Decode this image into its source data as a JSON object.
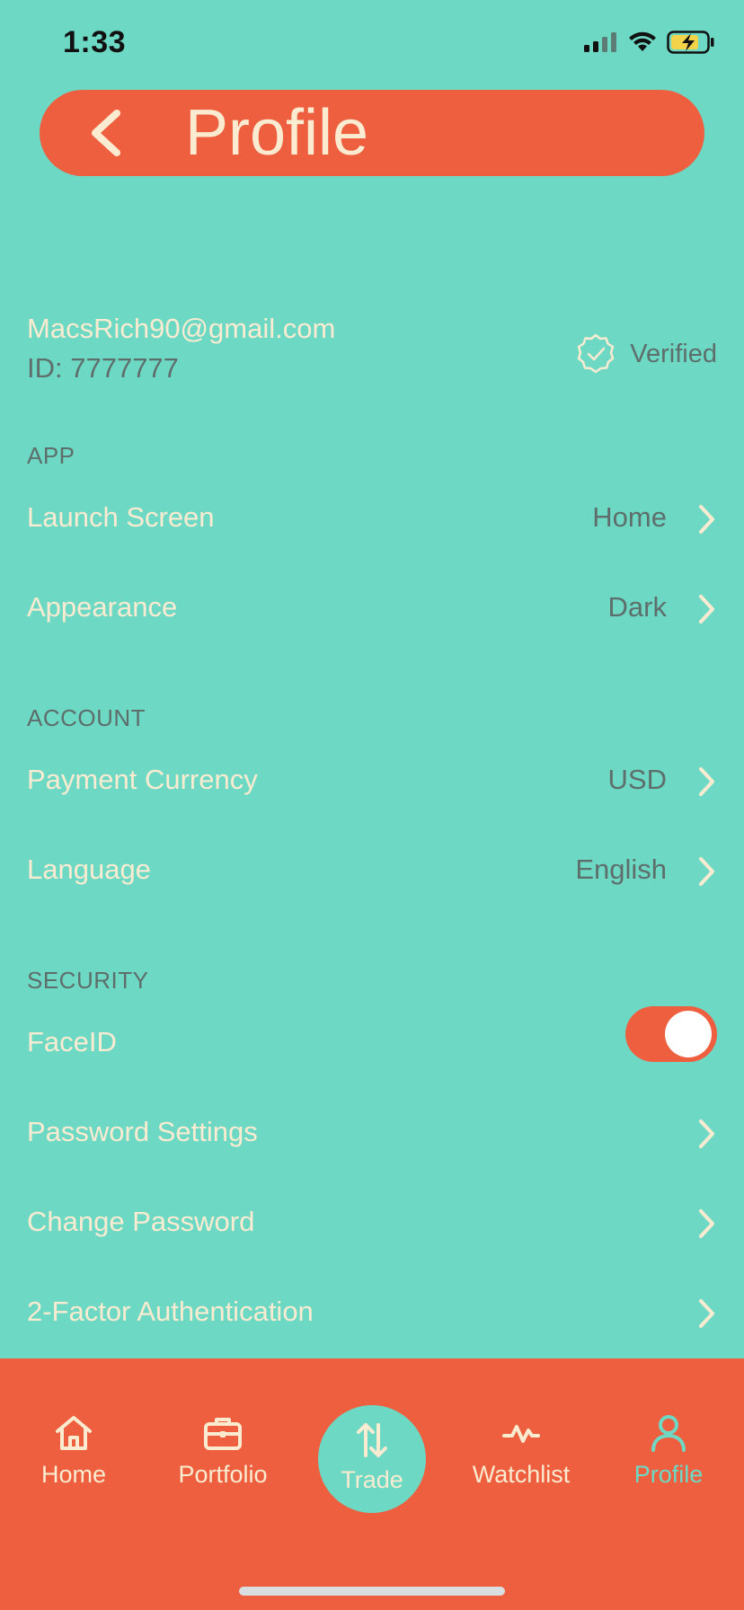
{
  "status_bar": {
    "time": "1:33"
  },
  "header": {
    "title": "Profile"
  },
  "user": {
    "email": "MacsRich90@gmail.com",
    "id_text": "ID: 7777777",
    "verified_label": "Verified"
  },
  "sections": {
    "app": {
      "title": "APP",
      "items": [
        {
          "label": "Launch Screen",
          "value": "Home"
        },
        {
          "label": "Appearance",
          "value": "Dark"
        }
      ]
    },
    "account": {
      "title": "ACCOUNT",
      "items": [
        {
          "label": "Payment Currency",
          "value": "USD"
        },
        {
          "label": "Language",
          "value": "English"
        }
      ]
    },
    "security": {
      "title": "SECURITY",
      "faceid": {
        "label": "FaceID",
        "enabled": true
      },
      "items": [
        {
          "label": "Password Settings"
        },
        {
          "label": "Change Password"
        },
        {
          "label": "2-Factor Authentication"
        }
      ]
    }
  },
  "tab_bar": {
    "tabs": [
      {
        "label": "Home",
        "icon": "home-icon"
      },
      {
        "label": "Portfolio",
        "icon": "briefcase-icon"
      },
      {
        "label": "Trade",
        "icon": "swap-arrows-icon"
      },
      {
        "label": "Watchlist",
        "icon": "pulse-icon"
      },
      {
        "label": "Profile",
        "icon": "user-icon",
        "active": true
      }
    ]
  },
  "colors": {
    "background": "#6DD9C5",
    "accent": "#EE5F3F",
    "text_light": "#FBEBD0",
    "text_muted": "#5E6E6B"
  }
}
